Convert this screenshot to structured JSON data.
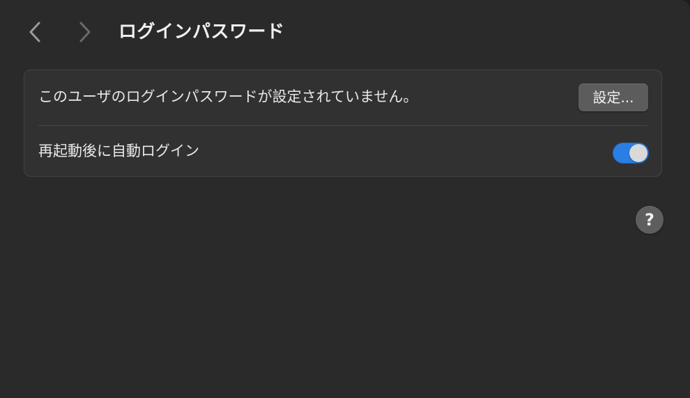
{
  "toolbar": {
    "back_icon": "chevron-left-icon",
    "forward_icon": "chevron-right-icon",
    "title": "ログインパスワード"
  },
  "settings": {
    "password_row": {
      "label": "このユーザのログインパスワードが設定されていません。",
      "button_label": "設定..."
    },
    "auto_login_row": {
      "label": "再起動後に自動ログイン",
      "toggle_on": true
    }
  },
  "help": {
    "label": "?"
  },
  "colors": {
    "background": "#2b2a2a",
    "group_background": "#323131",
    "toggle_on": "#2a7ee6",
    "button": "#5d5c5c"
  }
}
